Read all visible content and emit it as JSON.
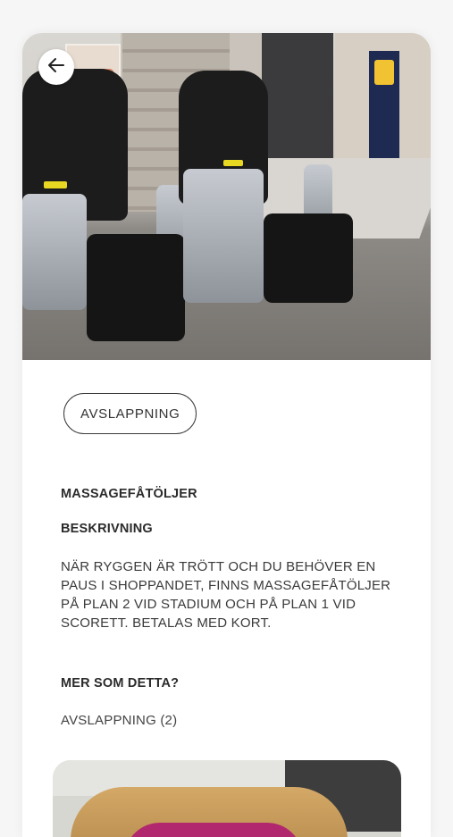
{
  "hero": {
    "back_icon": "arrow-left-icon",
    "image_subject": "massage chairs in shopping mall"
  },
  "detail": {
    "category_tag": "AVSLAPPNING",
    "title": "MASSAGEFÅTÖLJER",
    "description_heading": "BESKRIVNING",
    "description_text": "NÄR RYGGEN ÄR TRÖTT OCH DU BEHÖVER EN PAUS I SHOPPANDET, FINNS MASSAGEFÅTÖLJER PÅ PLAN 2 VID STADIUM OCH PÅ PLAN 1 VID SCORETT. BETALAS MED KORT."
  },
  "more": {
    "heading": "MER SOM DETTA?",
    "link_label": "AVSLAPPNING (2)"
  },
  "colors": {
    "background": "#f6f6f6",
    "card": "#ffffff",
    "text": "#2b2b2b",
    "border": "#3a3a3a"
  }
}
